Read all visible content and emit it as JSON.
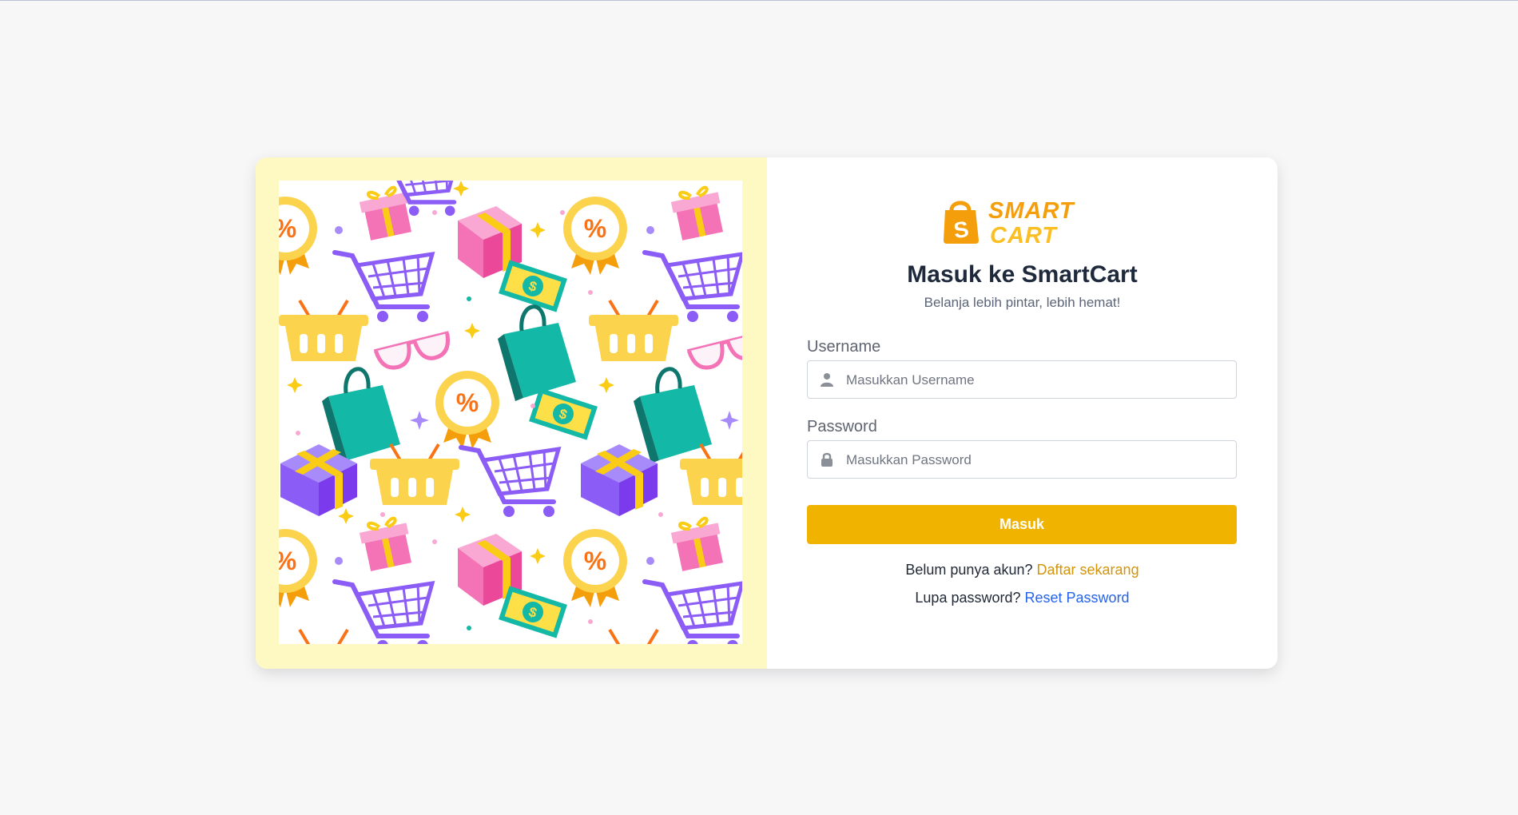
{
  "brand": {
    "logo_word_1": "SMART",
    "logo_word_2": "CART",
    "logo_badge": "S"
  },
  "login": {
    "title": "Masuk ke SmartCart",
    "subtitle": "Belanja lebih pintar, lebih hemat!",
    "username_label": "Username",
    "username_placeholder": "Masukkan Username",
    "username_value": "",
    "password_label": "Password",
    "password_placeholder": "Masukkan Password",
    "password_value": "",
    "submit_label": "Masuk",
    "register_prompt": "Belum punya akun?",
    "register_link": "Daftar sekarang",
    "forgot_prompt": "Lupa password?",
    "forgot_link": "Reset Password"
  },
  "illustration": {
    "description_icons": [
      "gift-icon",
      "shopping-cart-icon",
      "basket-icon",
      "shopping-bag-icon",
      "discount-badge-icon",
      "money-bill-icon",
      "glasses-icon",
      "sparkle-icon"
    ]
  },
  "colors": {
    "accent": "#f0b400",
    "left_panel_bg": "#fef9c3",
    "register_link": "#d4940a",
    "forgot_link": "#2563eb",
    "title": "#1e293b"
  }
}
